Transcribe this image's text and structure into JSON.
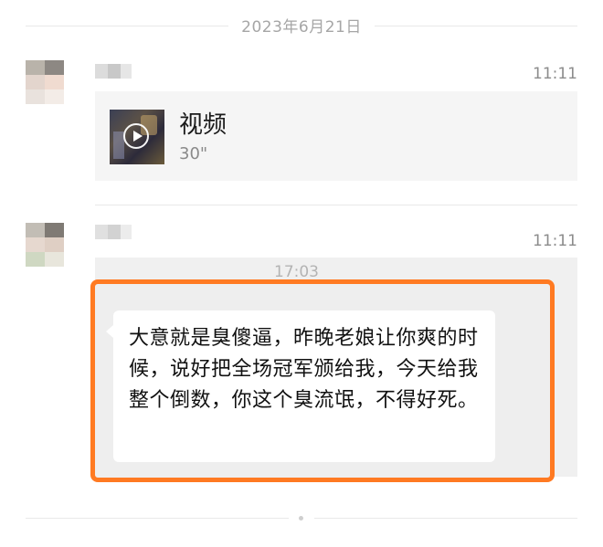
{
  "date_separator": "2023年6月21日",
  "messages": [
    {
      "time": "11:11",
      "video": {
        "title": "视频",
        "duration": "30\""
      }
    },
    {
      "time": "11:11",
      "quoted_time": "17:03",
      "bubble_text": "大意就是臭傻逼，昨晚老娘让你爽的时候，说好把全场冠军颁给我，今天给我整个倒数，你这个臭流氓，不得好死。"
    }
  ],
  "highlight_color": "#ff7a22",
  "icons": {
    "video_play": "play-circle-icon"
  }
}
